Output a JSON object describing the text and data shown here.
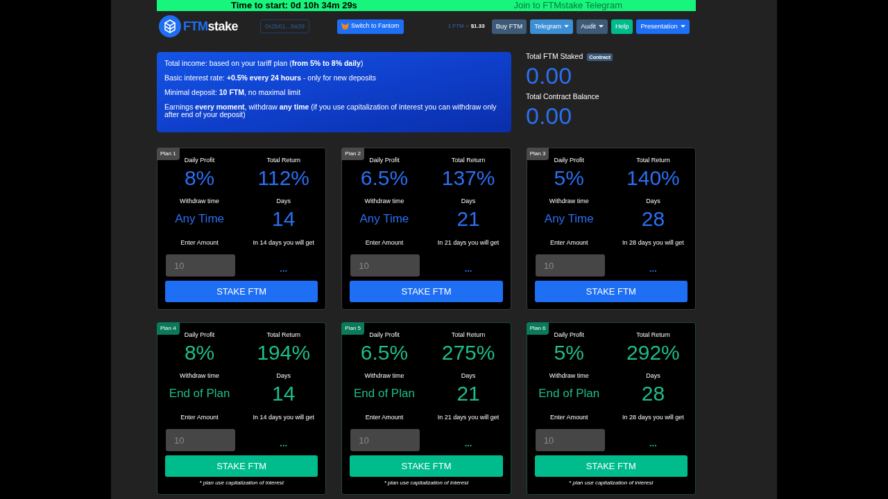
{
  "banner": {
    "countdown": "Time to start: 0d 10h 34m 29s",
    "telegram_link": "Join to FTMstake Telegram"
  },
  "header": {
    "logo": {
      "brand_part_1": "FTM",
      "brand_part_2": "stake"
    },
    "wallet": "0x2b61...9a39",
    "network_button": "Switch to Fantom",
    "price": {
      "label": "1 FTM =",
      "value": "$1.33"
    },
    "buttons": [
      {
        "label": "Buy FTM",
        "kind": "secondary",
        "dropdown": false
      },
      {
        "label": "Telegram",
        "kind": "info",
        "dropdown": true
      },
      {
        "label": "Audit",
        "kind": "secondary",
        "dropdown": true
      },
      {
        "label": "Help",
        "kind": "success",
        "dropdown": false
      },
      {
        "label": "Presentation",
        "kind": "primary",
        "dropdown": true
      }
    ]
  },
  "info": {
    "lines": [
      "Total income: based on your tariff plan (**from 5% to 8% daily**)",
      "Basic interest rate: **+0.5% every 24 hours** - only for new deposits",
      "Minimal deposit: **10 FTM**, no maximal limit",
      "Earnings **every moment**, withdraw **any time** (if you use capitalization of interest you can withdraw only after end of your deposit)"
    ]
  },
  "stats": [
    {
      "label": "Total FTM Staked",
      "badge": "Contract",
      "value": "0.00"
    },
    {
      "label": "Total Contract Balance",
      "value": "0.00"
    }
  ],
  "plans": [
    {
      "tag": "Plan 1",
      "kind": "flexible",
      "daily_profit_label": "Daily Profit",
      "daily_profit": "8%",
      "total_return_label": "Total Return",
      "total_return": "112%",
      "withdraw_label": "Withdraw time",
      "withdraw": "Any Time",
      "days_label": "Days",
      "days": "14",
      "amount_label": "Enter Amount",
      "amount_placeholder": "10",
      "result_label": "In 14 days you will get",
      "result": "...",
      "button": "STAKE FTM"
    },
    {
      "tag": "Plan 2",
      "kind": "flexible",
      "daily_profit_label": "Daily Profit",
      "daily_profit": "6.5%",
      "total_return_label": "Total Return",
      "total_return": "137%",
      "withdraw_label": "Withdraw time",
      "withdraw": "Any Time",
      "days_label": "Days",
      "days": "21",
      "amount_label": "Enter Amount",
      "amount_placeholder": "10",
      "result_label": "In 21 days you will get",
      "result": "...",
      "button": "STAKE FTM"
    },
    {
      "tag": "Plan 3",
      "kind": "flexible",
      "daily_profit_label": "Daily Profit",
      "daily_profit": "5%",
      "total_return_label": "Total Return",
      "total_return": "140%",
      "withdraw_label": "Withdraw time",
      "withdraw": "Any Time",
      "days_label": "Days",
      "days": "28",
      "amount_label": "Enter Amount",
      "amount_placeholder": "10",
      "result_label": "In 28 days you will get",
      "result": "...",
      "button": "STAKE FTM"
    },
    {
      "tag": "Plan 4",
      "kind": "locked",
      "daily_profit_label": "Daily Profit",
      "daily_profit": "8%",
      "total_return_label": "Total Return",
      "total_return": "194%",
      "withdraw_label": "Withdraw time",
      "withdraw": "End of Plan",
      "days_label": "Days",
      "days": "14",
      "amount_label": "Enter Amount",
      "amount_placeholder": "10",
      "result_label": "In 14 days you will get",
      "result": "...",
      "button": "STAKE FTM",
      "footnote": "* plan use capitalization of interest"
    },
    {
      "tag": "Plan 5",
      "kind": "locked",
      "daily_profit_label": "Daily Profit",
      "daily_profit": "6.5%",
      "total_return_label": "Total Return",
      "total_return": "275%",
      "withdraw_label": "Withdraw time",
      "withdraw": "End of Plan",
      "days_label": "Days",
      "days": "21",
      "amount_label": "Enter Amount",
      "amount_placeholder": "10",
      "result_label": "In 21 days you will get",
      "result": "...",
      "button": "STAKE FTM",
      "footnote": "* plan use capitalization of interest"
    },
    {
      "tag": "Plan 6",
      "kind": "locked",
      "daily_profit_label": "Daily Profit",
      "daily_profit": "5%",
      "total_return_label": "Total Return",
      "total_return": "292%",
      "withdraw_label": "Withdraw time",
      "withdraw": "End of Plan",
      "days_label": "Days",
      "days": "28",
      "amount_label": "Enter Amount",
      "amount_placeholder": "10",
      "result_label": "In 28 days you will get",
      "result": "...",
      "button": "STAKE FTM",
      "footnote": "* plan use capitalization of interest"
    }
  ]
}
